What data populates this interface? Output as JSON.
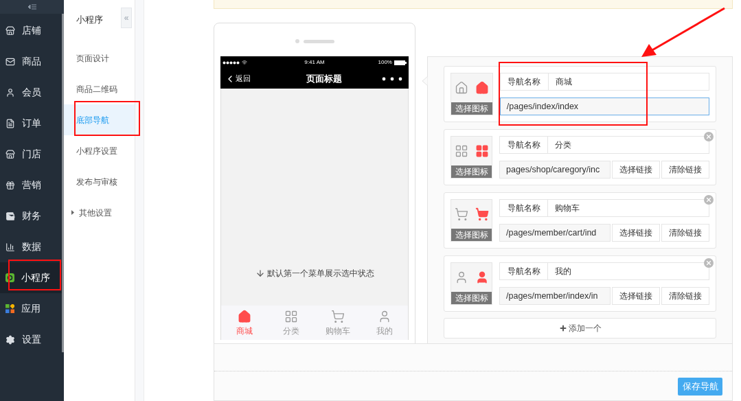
{
  "sidebar": {
    "items": [
      {
        "label": "店铺",
        "selected": false
      },
      {
        "label": "商品",
        "selected": false
      },
      {
        "label": "会员",
        "selected": false
      },
      {
        "label": "订单",
        "selected": false
      },
      {
        "label": "门店",
        "selected": false
      },
      {
        "label": "营销",
        "selected": false
      },
      {
        "label": "财务",
        "selected": false
      },
      {
        "label": "数据",
        "selected": false
      },
      {
        "label": "小程序",
        "selected": true
      },
      {
        "label": "应用",
        "selected": false
      },
      {
        "label": "设置",
        "selected": false
      }
    ]
  },
  "subnav": {
    "title": "小程序",
    "collapse": "«",
    "items": [
      {
        "label": "页面设计",
        "selected": false,
        "kind": "link"
      },
      {
        "label": "商品二维码",
        "selected": false,
        "kind": "link"
      },
      {
        "label": "底部导航",
        "selected": true,
        "kind": "link"
      },
      {
        "label": "小程序设置",
        "selected": false,
        "kind": "link"
      },
      {
        "label": "发布与审核",
        "selected": false,
        "kind": "link"
      },
      {
        "label": "其他设置",
        "selected": false,
        "kind": "group"
      }
    ]
  },
  "phone": {
    "status": {
      "time": "9:41 AM",
      "battery": "100%"
    },
    "back": "返回",
    "title": "页面标题",
    "hint": "默认第一个菜单展示选中状态",
    "tabs": [
      {
        "label": "商城",
        "selected": true
      },
      {
        "label": "分类",
        "selected": false
      },
      {
        "label": "购物车",
        "selected": false
      },
      {
        "label": "我的",
        "selected": false
      }
    ]
  },
  "editor": {
    "items": [
      {
        "icon_button": "选择图标",
        "name_label": "导航名称",
        "name": "商城",
        "link": "/pages/index/index",
        "focused": true,
        "removable": false
      },
      {
        "icon_button": "选择图标",
        "name_label": "导航名称",
        "name": "分类",
        "link": "pages/shop/caregory/inc",
        "focused": false,
        "removable": true,
        "link_buttons": [
          "选择链接",
          "清除链接"
        ]
      },
      {
        "icon_button": "选择图标",
        "name_label": "导航名称",
        "name": "购物车",
        "link": "/pages/member/cart/ind",
        "focused": false,
        "removable": true,
        "link_buttons": [
          "选择链接",
          "清除链接"
        ]
      },
      {
        "icon_button": "选择图标",
        "name_label": "导航名称",
        "name": "我的",
        "link": "/pages/member/index/in",
        "focused": false,
        "removable": true,
        "link_buttons": [
          "选择链接",
          "清除链接"
        ]
      }
    ],
    "add_button": "添加一个"
  },
  "footer": {
    "save_button": "保存导航"
  }
}
